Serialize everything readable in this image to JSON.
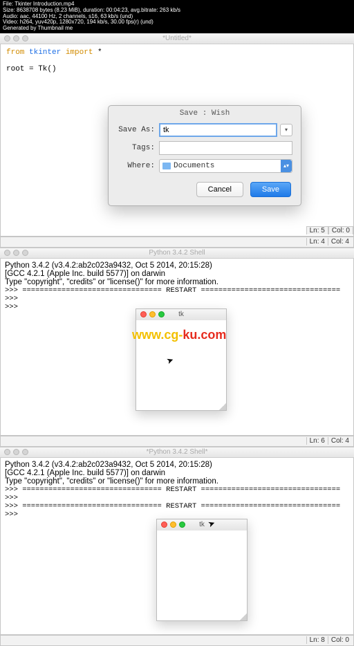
{
  "header": {
    "line1": "File: Tkinter Introduction.mp4",
    "line2": "Size: 8638708 bytes (8.23 MiB), duration: 00:04:23, avg.bitrate: 263 kb/s",
    "line3": "Audio: aac, 44100 Hz, 2 channels, s16, 63 kb/s (und)",
    "line4": "Video: h264, yuv420p, 1280x720, 194 kb/s, 30.00 fps(r) (und)",
    "line5": "Generated by Thumbnail me"
  },
  "editor_window": {
    "title": "*Untitled*",
    "code_from": "from",
    "code_module": " tkinter ",
    "code_import": "import",
    "code_rest": " *",
    "code_line2": "root = Tk()",
    "status_upper": {
      "ln": "Ln: 5",
      "col": "Col: 0"
    },
    "status_lower": {
      "ln": "Ln: 4",
      "col": "Col: 4"
    }
  },
  "save_dialog": {
    "title": "Save : Wish",
    "label_saveas": "Save As:",
    "value_saveas": "tk",
    "label_tags": "Tags:",
    "value_tags": "",
    "label_where": "Where:",
    "where_value": "Documents",
    "cancel": "Cancel",
    "save": "Save"
  },
  "shell1": {
    "title": "Python 3.4.2 Shell",
    "line1": "Python 3.4.2 (v3.4.2:ab2c023a9432, Oct  5 2014, 20:15:28)",
    "line2": "[GCC 4.2.1 (Apple Inc. build 5577)] on darwin",
    "line3": "Type \"copyright\", \"credits\" or \"license()\" for more information.",
    "line4": ">>> ================================ RESTART ================================",
    "line5": ">>> ",
    "line6": ">>> ",
    "tk_title": "tk",
    "status": {
      "ln": "Ln: 6",
      "col": "Col: 4"
    }
  },
  "shell2": {
    "title": "*Python 3.4.2 Shell*",
    "line1": "Python 3.4.2 (v3.4.2:ab2c023a9432, Oct  5 2014, 20:15:28)",
    "line2": "[GCC 4.2.1 (Apple Inc. build 5577)] on darwin",
    "line3": "Type \"copyright\", \"credits\" or \"license()\" for more information.",
    "line4": ">>> ================================ RESTART ================================",
    "line5": ">>> ",
    "line6": ">>> ================================ RESTART ================================",
    "line7": ">>> ",
    "tk_title": "tk",
    "status": {
      "ln": "Ln: 8",
      "col": "Col: 0"
    }
  },
  "watermark": {
    "part1": "www.cg-",
    "part2": "ku.com"
  }
}
